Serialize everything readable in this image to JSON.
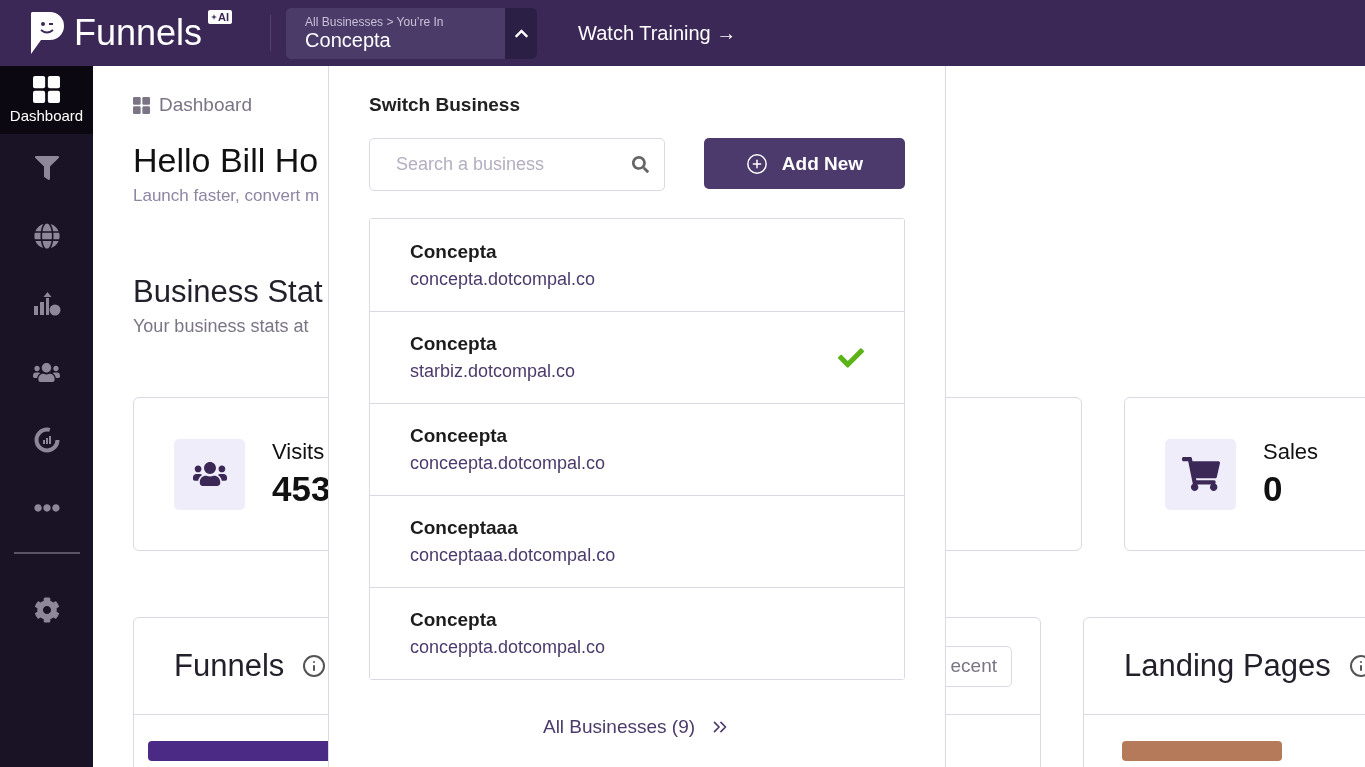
{
  "header": {
    "logo_text": "Funnels",
    "badge": "AI",
    "switcher": {
      "breadcrumb": "All Businesses > You’re In",
      "current": "Concepta",
      "expanded": true
    },
    "training_link": "Watch Training →"
  },
  "sidebar": {
    "items": [
      {
        "kind": "grid",
        "label": "Dashboard",
        "selected": true
      },
      {
        "kind": "funnel",
        "selected": false
      },
      {
        "kind": "globe",
        "selected": false
      },
      {
        "kind": "growth",
        "selected": false
      },
      {
        "kind": "team",
        "selected": false
      },
      {
        "kind": "gauge",
        "selected": false
      },
      {
        "kind": "more",
        "selected": false
      },
      {
        "kind": "divider"
      },
      {
        "kind": "settings",
        "selected": false
      }
    ]
  },
  "breadcrumb": "Dashboard",
  "greeting": "Hello Bill Ho",
  "tagline": "Launch faster, convert m",
  "stats": {
    "title": "Business Stat",
    "subtitle": "Your business stats at",
    "cards": [
      {
        "kind": "visits",
        "label": "Visits",
        "value": "453"
      },
      {
        "kind": "blank"
      },
      {
        "kind": "sales",
        "label": "Sales",
        "value": "0"
      }
    ]
  },
  "panels": [
    {
      "kind": "funnels",
      "title": "Funnels",
      "button": "ecent"
    },
    {
      "kind": "landing",
      "title": "Landing Pages"
    }
  ],
  "switch_business": {
    "title": "Switch Business",
    "search": {
      "placeholder": "Search a business"
    },
    "add_button": "Add New",
    "businesses": [
      {
        "name": "Concepta",
        "domain": "concepta.dotcompal.co",
        "selected": false
      },
      {
        "name": "Concepta",
        "domain": "starbiz.dotcompal.co",
        "selected": true
      },
      {
        "name": "Conceepta",
        "domain": "conceepta.dotcompal.co",
        "selected": false
      },
      {
        "name": "Conceptaaa",
        "domain": "conceptaaa.dotcompal.co",
        "selected": false
      },
      {
        "name": "Concepta",
        "domain": "conceppta.dotcompal.co",
        "selected": false
      }
    ],
    "footer_link": "All Businesses (9)"
  }
}
